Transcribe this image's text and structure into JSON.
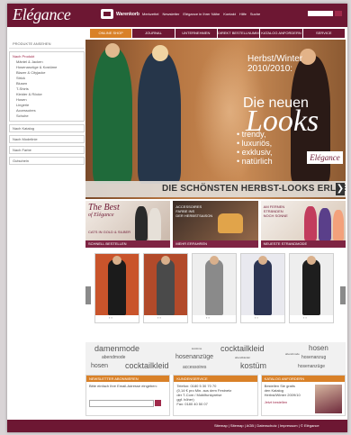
{
  "header": {
    "logo": "Elégance",
    "cart_label": "Warenkorb",
    "links": [
      "Merkzettel",
      "Newsletter",
      "Elégance in Ihrer Nähe",
      "Kontakt",
      "Hilfe",
      "Suche"
    ]
  },
  "nav": {
    "tabs": [
      "ONLINE SHOP",
      "JOURNAL",
      "UNTERNEHMEN",
      "DIREKT BESTELLNUMMER",
      "KATALOG ANFORDERN",
      "SERVICE"
    ],
    "active_index": 0
  },
  "sidebar": {
    "header": "PRODUKTE ANSEHEN",
    "items": [
      {
        "label": "Nach Produkt",
        "level": "top"
      },
      {
        "label": "Mäntel & Jacken",
        "level": "sub"
      },
      {
        "label": "Hosenanzüge & Kostüme",
        "level": "sub"
      },
      {
        "label": "Blazer & Cityjacke",
        "level": "sub"
      },
      {
        "label": "Strick",
        "level": "sub"
      },
      {
        "label": "Blusen",
        "level": "sub"
      },
      {
        "label": "T-Shirts",
        "level": "sub"
      },
      {
        "label": "Kleider & Röcke",
        "level": "sub"
      },
      {
        "label": "Hosen",
        "level": "sub"
      },
      {
        "label": "Lingerie",
        "level": "sub"
      },
      {
        "label": "Accessoires",
        "level": "sub"
      },
      {
        "label": "Schuhe",
        "level": "sub"
      }
    ],
    "links": [
      "Nach Katalog",
      "Nach Modelinie",
      "Nach Farbe",
      "Gutschein"
    ]
  },
  "hero": {
    "season_line1": "Herbst/Winter",
    "season_line2": "2010/2010:",
    "headline_prefix": "Die neuen",
    "headline": "Looks",
    "bullets": [
      "• trendy,",
      "• luxuriös,",
      "• exklusiv,",
      "• natürlich"
    ],
    "brand": "Elégance",
    "cta": "DIE SCHÖNSTEN HERBST-LOOKS ERLEBEN",
    "cta_arrow": "❯"
  },
  "promos": [
    {
      "title_line1": "The Best",
      "title_line2": "of Elégance",
      "text": "CATS IN GOLD & SILBER",
      "band": "SCHNELL BESTELLEN"
    },
    {
      "text_line1": "ACCESSOIRES",
      "text_line2": "FARBE INS",
      "text_line3": "DER HERBSTSAISON",
      "band": "MEHR ERFAHREN"
    },
    {
      "text_line1": "AM FERNEN",
      "text_line2": "STRÄNDEN",
      "text_line3": "NOCH SONNE",
      "band": "NEUESTE STRANDMODE"
    }
  ],
  "carousel": {
    "left_arrow": "‹",
    "right_arrow": "›",
    "items": [
      {
        "bg": "#c9542b",
        "outfit": "#1b1b1b",
        "dots": "▪ ▪"
      },
      {
        "bg": "#b24a2a",
        "outfit": "#4a4a4a",
        "dots": "▪ ▪"
      },
      {
        "bg": "#eeeeee",
        "outfit": "#8a8a8a",
        "dots": "▪ ▪"
      },
      {
        "bg": "#e9e9ef",
        "outfit": "#2c3553",
        "dots": "▪ ▪"
      },
      {
        "bg": "#eeeeee",
        "outfit": "#1e1e1e",
        "dots": "▪ ▪"
      }
    ]
  },
  "tagcloud": [
    {
      "text": "damenmode",
      "size": 9
    },
    {
      "text": "abendmode",
      "size": 5
    },
    {
      "text": "hosen",
      "size": 7
    },
    {
      "text": "cocktailkleid",
      "size": 9
    },
    {
      "text": "kostüme",
      "size": 3
    },
    {
      "text": "hosenanzüge",
      "size": 7
    },
    {
      "text": "accessoires",
      "size": 5
    },
    {
      "text": "cocktailkleid",
      "size": 9
    },
    {
      "text": "abendkleider",
      "size": 3
    },
    {
      "text": "kostüm",
      "size": 9
    },
    {
      "text": "abendmode",
      "size": 3
    },
    {
      "text": "hosen",
      "size": 8
    },
    {
      "text": "hosenanzug",
      "size": 5
    },
    {
      "text": "hosenanzüge",
      "size": 5
    }
  ],
  "bottom": {
    "newsletter": {
      "header": "NEWSLETTER ABONNIEREN",
      "text": "Bitte einfach Ihre Email-Adresse eingeben:"
    },
    "service": {
      "header": "KUNDENSERVICE",
      "text_lines": [
        "Telefon: 0180 5 30 70 70",
        "(0,14 € pro Min. aus dem Festnetz",
        "der T-Com / Mobilfunkpreise",
        "ggf. höher)",
        "Fax: 0180 40 50 07"
      ]
    },
    "catalog": {
      "header": "KATALOG ANFORDERN",
      "text_lines": [
        "Bestellen Sie gratis",
        "den Katalog",
        "Herbst/Winter 2009/10"
      ],
      "link": "Jetzt bestellen"
    }
  },
  "footer": {
    "links": "Sitemap | Sitemap | AGB | Datenschutz | Impressum | © Elégance"
  },
  "colors": {
    "brand": "#6d1733",
    "accent": "#d98128"
  }
}
